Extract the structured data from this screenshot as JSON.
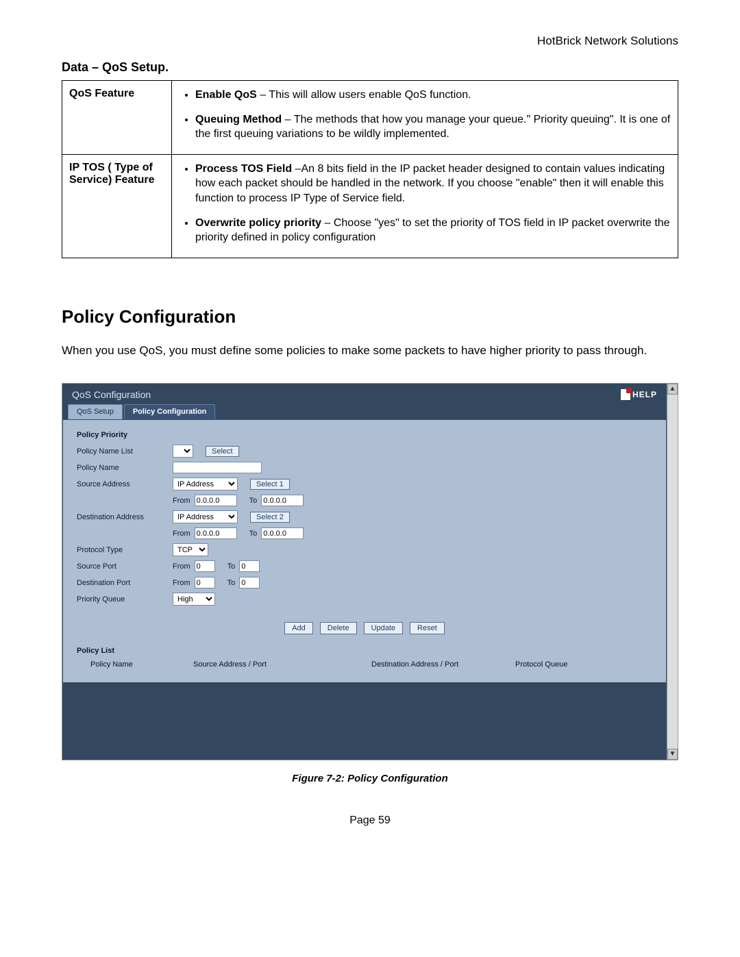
{
  "header": {
    "right": "HotBrick Network Solutions"
  },
  "section_title": "Data – QoS Setup.",
  "table": {
    "row1": {
      "label": "QoS Feature",
      "items": [
        {
          "bold": "Enable QoS",
          "rest": " – This will allow users enable QoS function."
        },
        {
          "bold": "Queuing Method",
          "rest": " – The methods that how you manage your queue.\" Priority queuing\". It is one of the first queuing variations to be wildly implemented."
        }
      ]
    },
    "row2": {
      "label": "IP TOS ( Type of Service) Feature",
      "items": [
        {
          "bold": "Process TOS Field",
          "rest": " –An 8 bits field in the IP packet header designed to contain values indicating how each packet should be handled in the network. If you choose \"enable\" then it will enable this function to process IP Type of Service field."
        },
        {
          "bold": "Overwrite policy priority",
          "rest": " – Choose \"yes\" to set the priority of TOS field in IP packet overwrite the priority defined in policy configuration"
        }
      ]
    }
  },
  "heading": "Policy Configuration",
  "body_text": "When you use QoS, you must define some policies to make some packets to have higher priority to pass through.",
  "ui": {
    "panel_title": "QoS Configuration",
    "help_label": "HELP",
    "tabs": {
      "setup": "QoS Setup",
      "policy": "Policy Configuration"
    },
    "sections": {
      "policy_priority": "Policy Priority",
      "policy_list": "Policy List"
    },
    "labels": {
      "policy_name_list": "Policy Name List",
      "policy_name": "Policy Name",
      "source_address": "Source Address",
      "destination_address": "Destination Address",
      "protocol_type": "Protocol Type",
      "source_port": "Source Port",
      "destination_port": "Destination Port",
      "priority_queue": "Priority Queue",
      "from": "From",
      "to": "To"
    },
    "values": {
      "addr_type": "IP Address",
      "ip_default": "0.0.0.0",
      "port_default": "0",
      "protocol": "TCP",
      "priority": "High"
    },
    "buttons": {
      "select": "Select",
      "select1": "Select 1",
      "select2": "Select 2",
      "add": "Add",
      "delete": "Delete",
      "update": "Update",
      "reset": "Reset"
    },
    "list_headers": {
      "name": "Policy Name",
      "src": "Source Address / Port",
      "dst": "Destination Address / Port",
      "proto": "Protocol  Queue"
    }
  },
  "caption": "Figure 7-2: Policy Configuration",
  "page": "Page 59"
}
